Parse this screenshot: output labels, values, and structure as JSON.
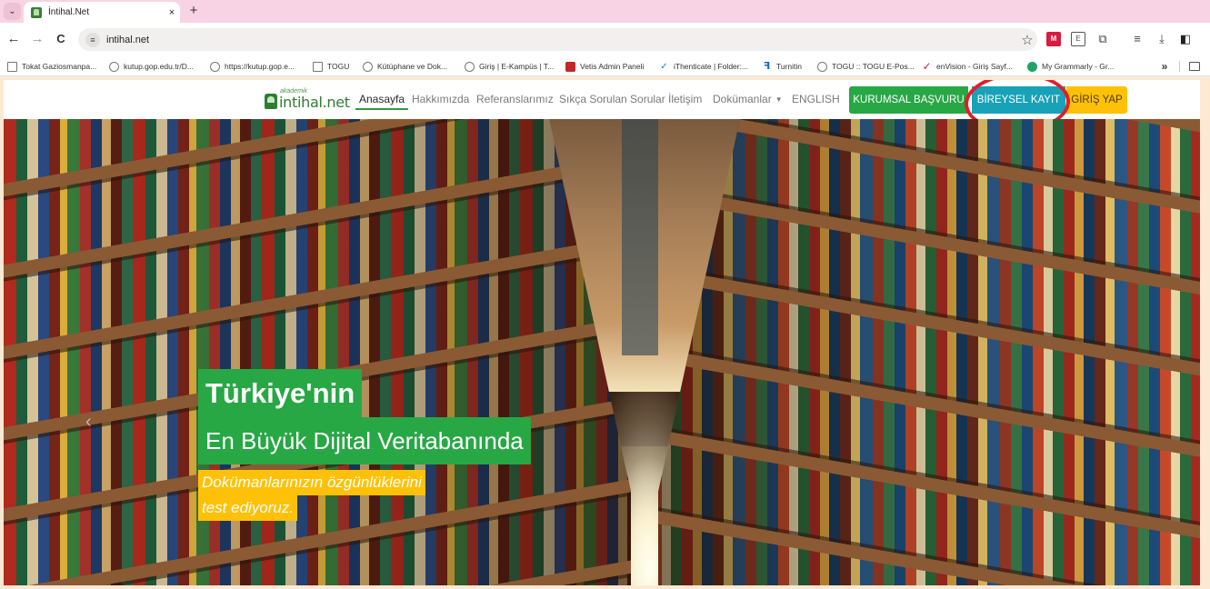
{
  "browser": {
    "tab": {
      "title": "İntihal.Net",
      "close": "×"
    },
    "new_tab": "+",
    "tab_menu": "⌄",
    "nav": {
      "back": "←",
      "forward": "→",
      "reload": "C"
    },
    "address": {
      "url": "intihal.net"
    },
    "bookmarks": [
      {
        "label": "Tokat Gaziosmanpa...",
        "icon": "page-icon"
      },
      {
        "label": "kutup.gop.edu.tr/D...",
        "icon": "globe-icon"
      },
      {
        "label": "https://kutup.gop.e...",
        "icon": "globe-icon"
      },
      {
        "label": "TOGU",
        "icon": "page-icon"
      },
      {
        "label": "Kütüphane ve Dok...",
        "icon": "globe-icon"
      },
      {
        "label": "Giriş | E-Kampüs | T...",
        "icon": "globe-icon"
      },
      {
        "label": "Vetis Admin Paneli",
        "icon": "vetis-icon"
      },
      {
        "label": "iThenticate | Folder:...",
        "icon": "check-icon"
      },
      {
        "label": "Turnitin",
        "icon": "turnitin-icon"
      },
      {
        "label": "TOGU :: TOGU E-Pos...",
        "icon": "globe-icon"
      },
      {
        "label": "enVision - Giriş Sayf...",
        "icon": "envision-check-icon"
      },
      {
        "label": "My Grammarly - Gr...",
        "icon": "grammarly-icon"
      }
    ],
    "bookmarks_more": "»"
  },
  "site": {
    "logo": {
      "small": "akademik",
      "text": "intihal.net"
    },
    "nav": [
      {
        "label": "Anasayfa",
        "active": true
      },
      {
        "label": "Hakkımızda"
      },
      {
        "label": "Referanslarımız"
      },
      {
        "label": "Sıkça Sorulan Sorular"
      },
      {
        "label": "İletişim"
      },
      {
        "label": "Dokümanlar"
      },
      {
        "label": "ENGLISH"
      }
    ],
    "buttons": {
      "kurumsal": "KURUMSAL BAŞVURU",
      "bireysel": "BİREYSEL KAYIT",
      "giris": "GİRİŞ YAP"
    },
    "hero": {
      "line1": "Türkiye'nin",
      "line2": "En Büyük Dijital Veritabanında",
      "line3": "Dokümanlarınızın özgünlüklerini",
      "line4": "test ediyoruz."
    }
  },
  "colors": {
    "green": "#28a745",
    "blue": "#17a2b8",
    "yellow": "#ffc107",
    "highlight_circle": "#e01e2a"
  }
}
